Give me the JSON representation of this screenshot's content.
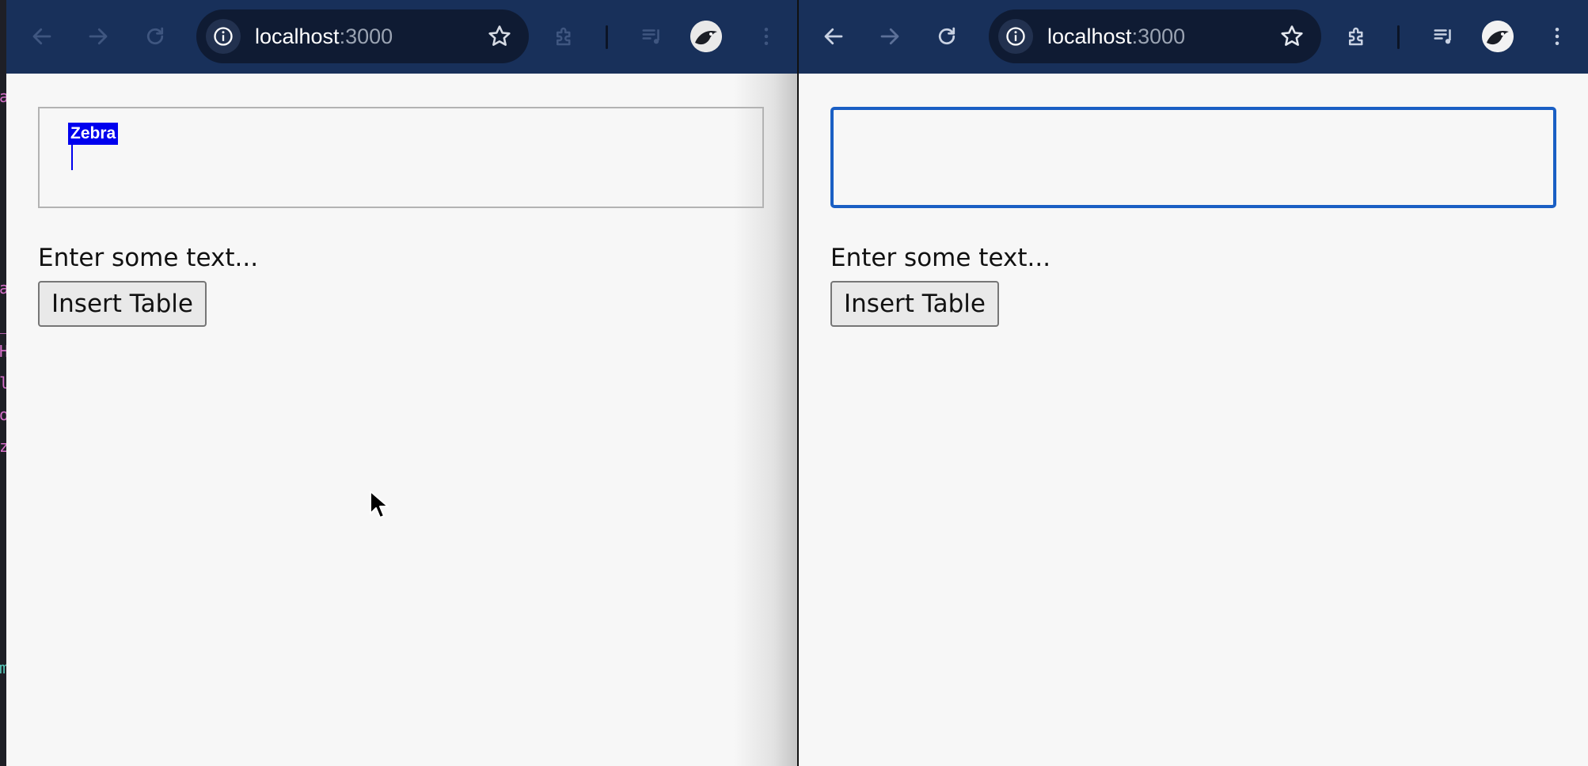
{
  "background_editor": {
    "glyphs": [
      {
        "char": "a",
        "color": "#d46fc8"
      },
      {
        "char": "a",
        "color": "#d46fc8"
      },
      {
        "char": "_",
        "color": "#d46fc8"
      },
      {
        "char": "H",
        "color": "#d46fc8"
      },
      {
        "char": "l",
        "color": "#d46fc8"
      },
      {
        "char": "o",
        "color": "#d46fc8"
      },
      {
        "char": "z",
        "color": "#d46fc8"
      },
      {
        "char": "m",
        "color": "#58c7b8"
      }
    ]
  },
  "windows": {
    "left": {
      "url": {
        "host": "localhost",
        "port": ":3000"
      },
      "editor": {
        "selected_word": "Zebra",
        "focused": false
      },
      "placeholder": "Enter some text...",
      "insert_button": "Insert Table",
      "nav_state": {
        "back_enabled": false,
        "forward_enabled": false,
        "reload_enabled": false
      }
    },
    "right": {
      "url": {
        "host": "localhost",
        "port": ":3000"
      },
      "editor": {
        "selected_word": "",
        "focused": true
      },
      "placeholder": "Enter some text...",
      "insert_button": "Insert Table",
      "nav_state": {
        "back_enabled": true,
        "forward_enabled": false,
        "reload_enabled": true
      }
    }
  },
  "icons": {
    "back": "arrow-left-icon",
    "forward": "arrow-right-icon",
    "reload": "reload-icon",
    "site_info": "info-icon",
    "bookmark": "star-icon",
    "extensions": "puzzle-icon",
    "media": "media-queue-icon",
    "profile": "avatar-icon",
    "menu": "kebab-menu-icon",
    "pointer": "mouse-pointer-icon"
  },
  "colors": {
    "toolbar": "#18305a",
    "omnibox": "#0f1b33",
    "selection": "#0000ee",
    "focus_ring": "#1a5fc4",
    "page_bg": "#f7f7f7"
  }
}
